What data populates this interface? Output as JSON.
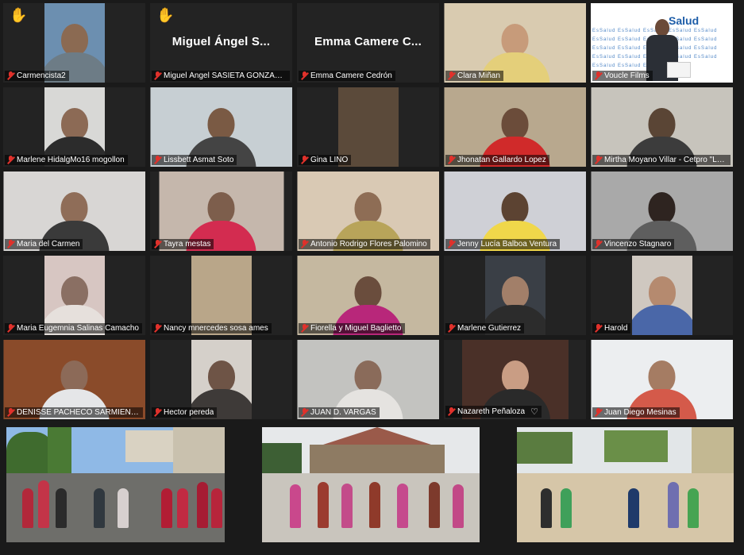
{
  "participants": [
    {
      "name": "Carmencista2",
      "raised_hand": true
    },
    {
      "name": "Miguel Ángel SASIETA GONZALEZ",
      "display_title": "Miguel Ángel S...",
      "raised_hand": true
    },
    {
      "name": "Emma Camere Cedrón",
      "display_title": "Emma Camere C..."
    },
    {
      "name": "Clara Miñan"
    },
    {
      "name": "Voucle Films",
      "active_speaker": true,
      "logo_text": "Salud",
      "logo_pattern_text": "EsSalud"
    },
    {
      "name": "Marlene HidalgMo16 mogollon"
    },
    {
      "name": "Lissbett Asmat Soto"
    },
    {
      "name": "Gina LINO"
    },
    {
      "name": "Jhonatan Gallardo Lopez"
    },
    {
      "name": "Mirtha Moyano Villar - Cetpro \"Lo..."
    },
    {
      "name": "Maria del Carmen"
    },
    {
      "name": "Tayra mestas"
    },
    {
      "name": "Antonio Rodrigo Flores Palomino"
    },
    {
      "name": "Jenny Lucía Balboa Ventura"
    },
    {
      "name": "Vincenzo Stagnaro"
    },
    {
      "name": "Maria Eugemnia Salinas Camacho"
    },
    {
      "name": "Nancy mnercedes sosa ames"
    },
    {
      "name": "Fiorella y Miguel Baglietto"
    },
    {
      "name": "Marlene Gutierrez"
    },
    {
      "name": "Harold"
    },
    {
      "name": "DENISSE PACHECO SARMIENTO"
    },
    {
      "name": "Hector pereda"
    },
    {
      "name": "JUAN D. VARGAS"
    },
    {
      "name": "Nazareth Peñaloza",
      "heart": "♡"
    },
    {
      "name": "Juan Diego Mesinas"
    }
  ],
  "icons": {
    "raised_hand": "✋",
    "muted_mic": "muted-microphone-icon"
  },
  "colors": {
    "active_border": "#c8d832",
    "muted": "#e0312b",
    "hand": "#f2b81f",
    "background": "#1a1a1a"
  }
}
